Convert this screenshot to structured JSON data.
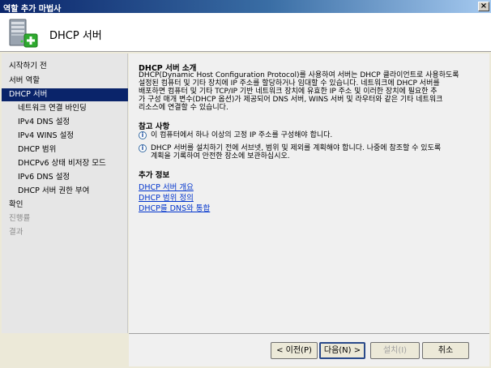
{
  "window": {
    "title": "역할 추가 마법사"
  },
  "header": {
    "title": "DHCP 서버",
    "icon": "server-add-icon"
  },
  "nav": {
    "items": [
      {
        "label": "시작하기 전",
        "state": "normal",
        "level": 0
      },
      {
        "label": "서버 역할",
        "state": "normal",
        "level": 0
      },
      {
        "label": "DHCP 서버",
        "state": "active",
        "level": 0
      },
      {
        "label": "네트워크 연결 바인딩",
        "state": "normal",
        "level": 1
      },
      {
        "label": "IPv4 DNS 설정",
        "state": "normal",
        "level": 1
      },
      {
        "label": "IPv4 WINS 설정",
        "state": "normal",
        "level": 1
      },
      {
        "label": "DHCP 범위",
        "state": "normal",
        "level": 1
      },
      {
        "label": "DHCPv6 상태 비저장 모드",
        "state": "normal",
        "level": 1
      },
      {
        "label": "IPv6 DNS 설정",
        "state": "normal",
        "level": 1
      },
      {
        "label": "DHCP 서버 권한 부여",
        "state": "normal",
        "level": 1
      },
      {
        "label": "확인",
        "state": "normal",
        "level": 0
      },
      {
        "label": "진행률",
        "state": "disabled",
        "level": 0
      },
      {
        "label": "결과",
        "state": "disabled",
        "level": 0
      }
    ]
  },
  "content": {
    "intro_title": "DHCP 서버 소개",
    "intro_lines": [
      "DHCP(Dynamic Host Configuration Protocol)를 사용하여 서버는 DHCP 클라이언트로 사용하도록",
      "설정된 컴퓨터 및 기타 장치에 IP 주소를 할당하거나 임대할 수 있습니다. 네트워크에 DHCP 서버를",
      "배포하면 컴퓨터 및 기타 TCP/IP 기반 네트워크 장치에 유효한 IP 주소 및 이러한 장치에 필요한 추",
      "가 구성 매개 변수(DHCP 옵션)가 제공되어 DNS 서버, WINS 서버 및 라우터와 같은 기타 네트워크",
      "리소스에 연결할 수 있습니다."
    ],
    "notes_title": "참고 사항",
    "notes": [
      {
        "icon": "info-icon",
        "lines": [
          "이 컴퓨터에서 하나 이상의 고정 IP 주소를 구성해야 합니다."
        ]
      },
      {
        "icon": "info-icon",
        "lines": [
          "DHCP 서버를 설치하기 전에 서브넷, 범위 및 제외를 계획해야 합니다. 나중에 참조할 수 있도록",
          "계획을 기록하여 안전한 장소에 보관하십시오."
        ]
      }
    ],
    "more_title": "추가 정보",
    "links": [
      "DHCP 서버 개요",
      "DHCP 범위 정의",
      "DHCP를 DNS와 통합"
    ]
  },
  "footer": {
    "prev_label": "< 이전(P)",
    "next_label": "다음(N) >",
    "install_label": "설치(I)",
    "cancel_label": "취소"
  }
}
